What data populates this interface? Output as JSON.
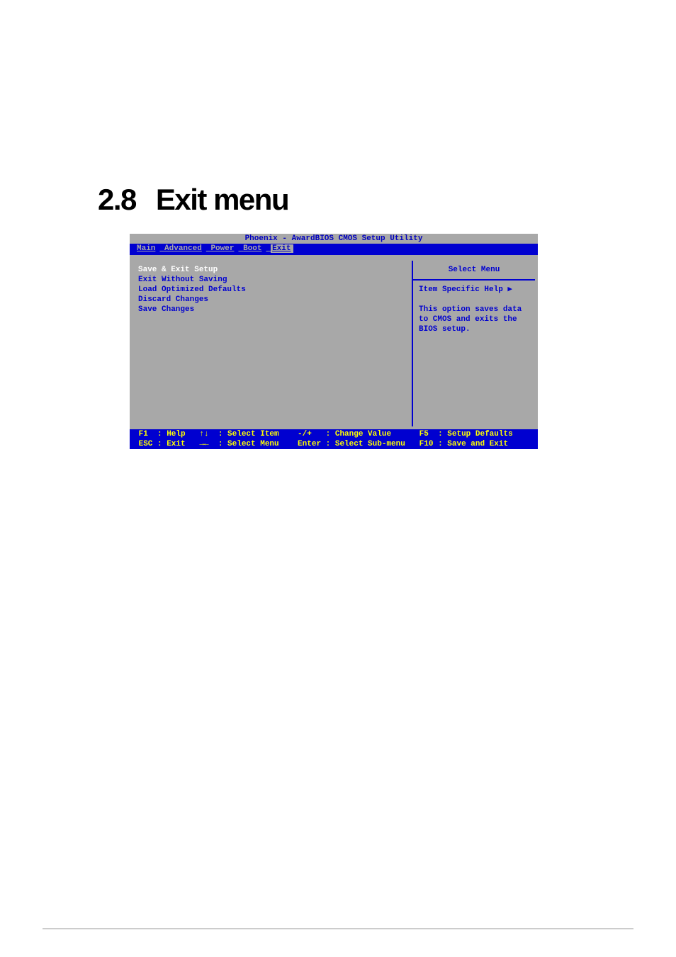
{
  "heading": {
    "number": "2.8",
    "title": "Exit menu"
  },
  "bios": {
    "title": "Phoenix - AwardBIOS CMOS Setup Utility",
    "menus": [
      "Main",
      "Advanced",
      "Power",
      "Boot",
      "Exit"
    ],
    "active_menu": "Exit",
    "left_items": {
      "selected": "Save & Exit Setup",
      "items": [
        "Exit Without Saving",
        "Load Optimized Defaults",
        "Discard Changes",
        "Save Changes"
      ]
    },
    "right_panel": {
      "title": "Select Menu",
      "help_label": "Item Specific Help ▶",
      "help_text_1": "This option saves data",
      "help_text_2": "to CMOS and exits the",
      "help_text_3": "BIOS setup."
    },
    "footer": {
      "row1": " F1  : Help   ↑↓  : Select Item    -/+   : Change Value      F5  : Setup Defaults",
      "row2": " ESC : Exit   →←  : Select Menu    Enter : Select Sub-menu   F10 : Save and Exit"
    }
  }
}
